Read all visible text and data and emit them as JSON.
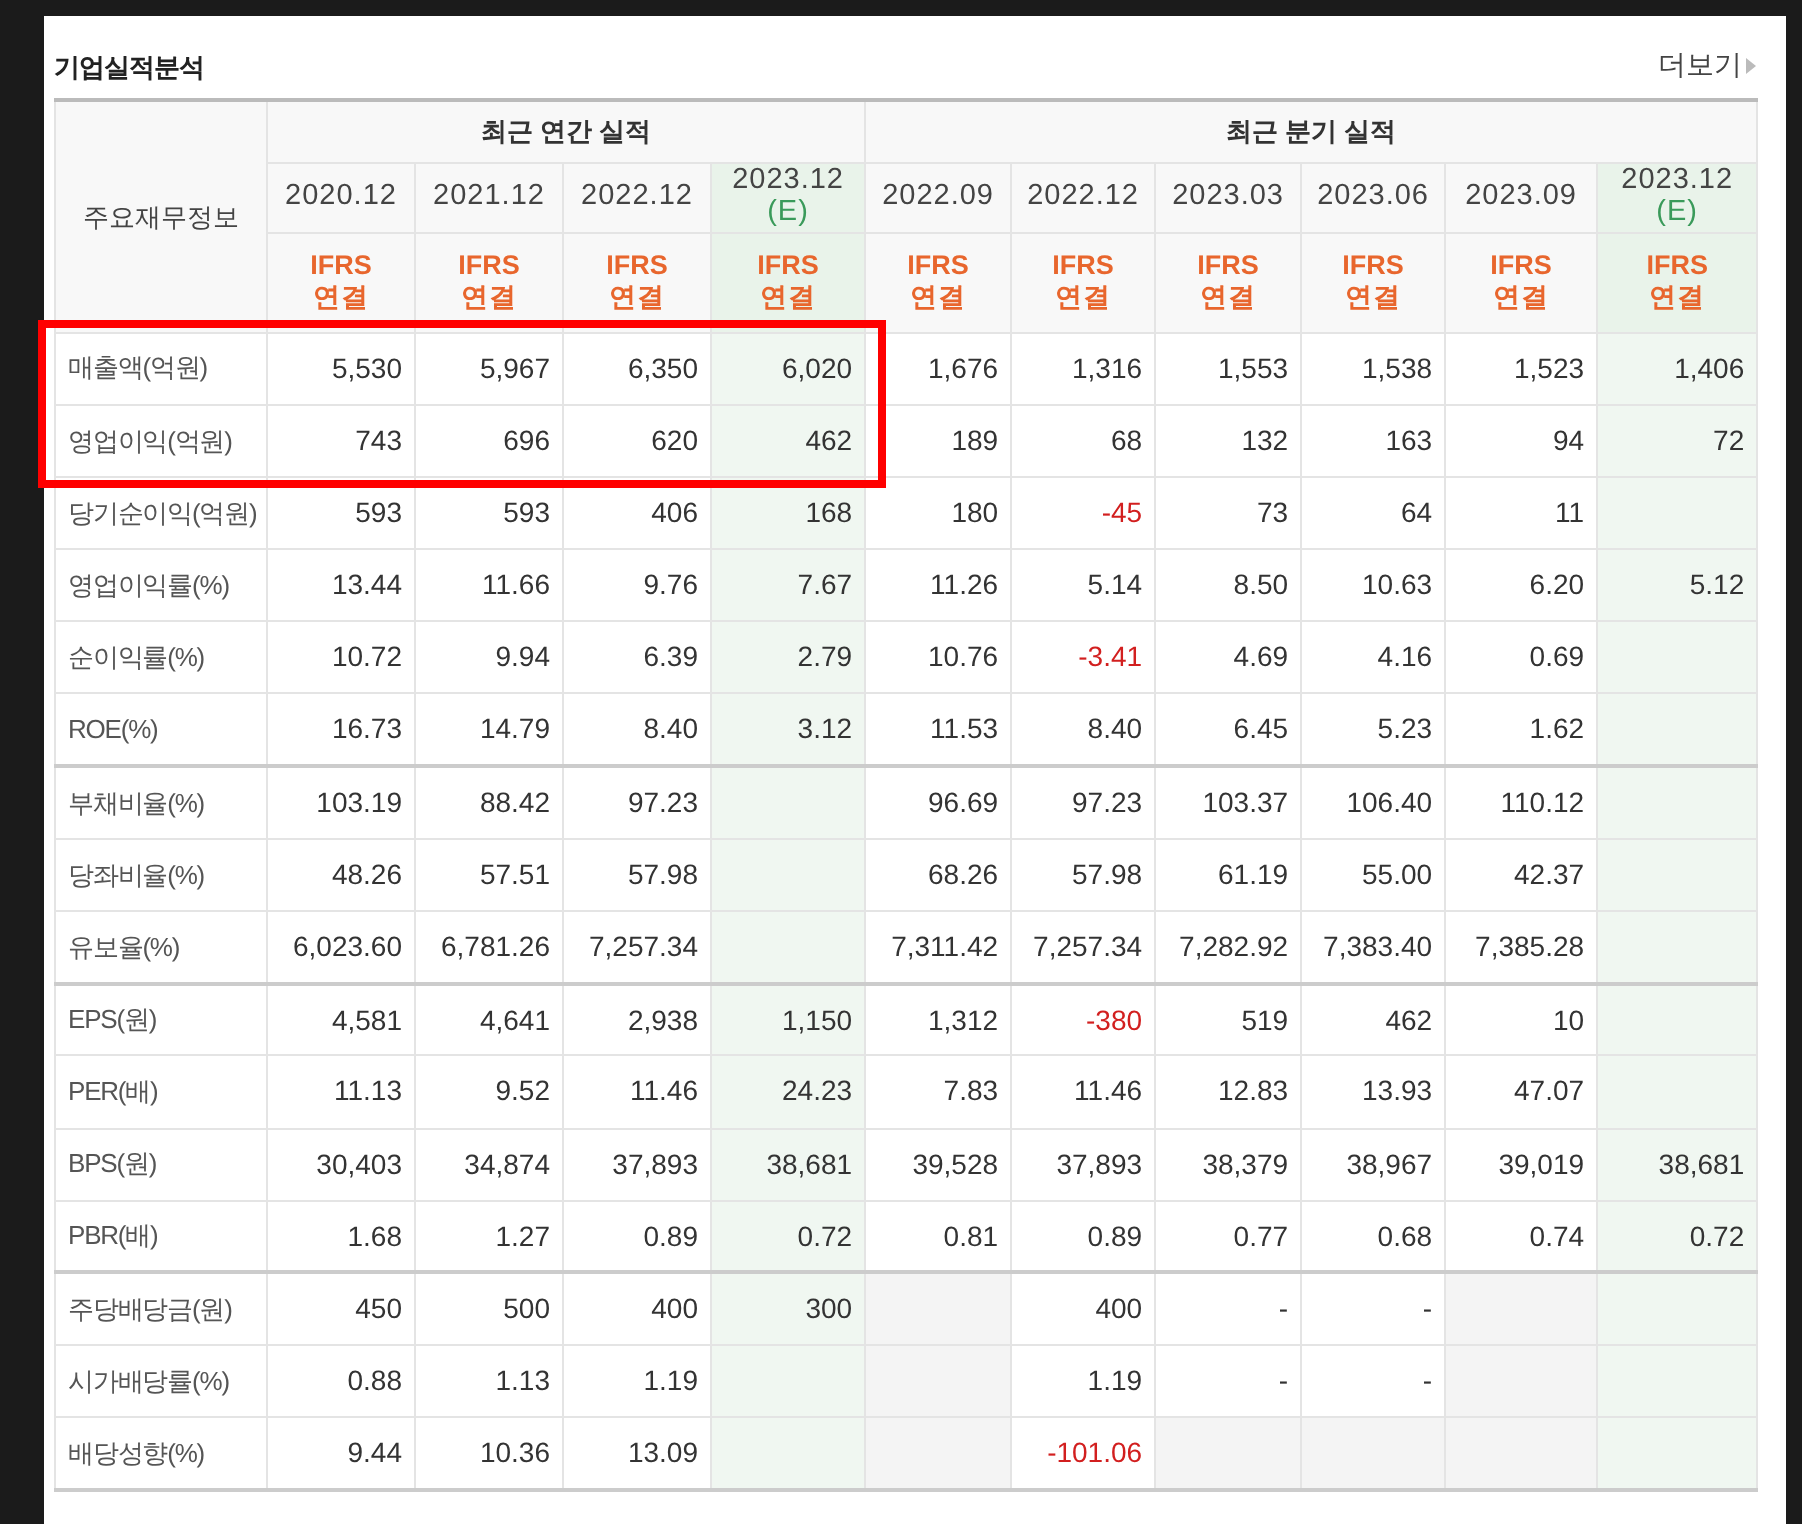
{
  "title": "기업실적분석",
  "more_link": {
    "label": "더보기"
  },
  "table": {
    "corner": "주요재무정보",
    "groups": [
      {
        "label": "최근 연간 실적",
        "columns": [
          {
            "date": "2020.12",
            "estimate": false,
            "basis": "IFRS",
            "scope": "연결"
          },
          {
            "date": "2021.12",
            "estimate": false,
            "basis": "IFRS",
            "scope": "연결"
          },
          {
            "date": "2022.12",
            "estimate": false,
            "basis": "IFRS",
            "scope": "연결"
          },
          {
            "date": "2023.12",
            "note": "(E)",
            "estimate": true,
            "basis": "IFRS",
            "scope": "연결"
          }
        ]
      },
      {
        "label": "최근 분기 실적",
        "columns": [
          {
            "date": "2022.09",
            "estimate": false,
            "basis": "IFRS",
            "scope": "연결"
          },
          {
            "date": "2022.12",
            "estimate": false,
            "basis": "IFRS",
            "scope": "연결"
          },
          {
            "date": "2023.03",
            "estimate": false,
            "basis": "IFRS",
            "scope": "연결"
          },
          {
            "date": "2023.06",
            "estimate": false,
            "basis": "IFRS",
            "scope": "연결"
          },
          {
            "date": "2023.09",
            "estimate": false,
            "basis": "IFRS",
            "scope": "연결"
          },
          {
            "date": "2023.12",
            "note": "(E)",
            "estimate": true,
            "basis": "IFRS",
            "scope": "연결"
          }
        ]
      }
    ],
    "sections": [
      {
        "rows": [
          {
            "label": "매출액(억원)",
            "highlighted": true,
            "cells": [
              "5,530",
              "5,967",
              "6,350",
              "6,020",
              "1,676",
              "1,316",
              "1,553",
              "1,538",
              "1,523",
              "1,406"
            ]
          },
          {
            "label": "영업이익(억원)",
            "highlighted": true,
            "cells": [
              "743",
              "696",
              "620",
              "462",
              "189",
              "68",
              "132",
              "163",
              "94",
              "72"
            ]
          },
          {
            "label": "당기순이익(억원)",
            "highlighted": false,
            "cells": [
              "593",
              "593",
              "406",
              "168",
              "180",
              {
                "text": "-45",
                "negative": true
              },
              "73",
              "64",
              "11",
              null
            ]
          },
          {
            "label": "영업이익률(%)",
            "highlighted": false,
            "cells": [
              "13.44",
              "11.66",
              "9.76",
              "7.67",
              "11.26",
              "5.14",
              "8.50",
              "10.63",
              "6.20",
              "5.12"
            ]
          },
          {
            "label": "순이익률(%)",
            "highlighted": false,
            "cells": [
              "10.72",
              "9.94",
              "6.39",
              "2.79",
              "10.76",
              {
                "text": "-3.41",
                "negative": true
              },
              "4.69",
              "4.16",
              "0.69",
              null
            ]
          },
          {
            "label": "ROE(%)",
            "highlighted": false,
            "cells": [
              "16.73",
              "14.79",
              "8.40",
              "3.12",
              "11.53",
              "8.40",
              "6.45",
              "5.23",
              "1.62",
              null
            ]
          }
        ]
      },
      {
        "rows": [
          {
            "label": "부채비율(%)",
            "highlighted": false,
            "cells": [
              "103.19",
              "88.42",
              "97.23",
              null,
              "96.69",
              "97.23",
              "103.37",
              "106.40",
              "110.12",
              null
            ]
          },
          {
            "label": "당좌비율(%)",
            "highlighted": false,
            "cells": [
              "48.26",
              "57.51",
              "57.98",
              null,
              "68.26",
              "57.98",
              "61.19",
              "55.00",
              "42.37",
              null
            ]
          },
          {
            "label": "유보율(%)",
            "highlighted": false,
            "cells": [
              "6,023.60",
              "6,781.26",
              "7,257.34",
              null,
              "7,311.42",
              "7,257.34",
              "7,282.92",
              "7,383.40",
              "7,385.28",
              null
            ]
          }
        ]
      },
      {
        "rows": [
          {
            "label": "EPS(원)",
            "highlighted": false,
            "cells": [
              "4,581",
              "4,641",
              "2,938",
              "1,150",
              "1,312",
              {
                "text": "-380",
                "negative": true
              },
              "519",
              "462",
              "10",
              null
            ]
          },
          {
            "label": "PER(배)",
            "highlighted": false,
            "cells": [
              "11.13",
              "9.52",
              "11.46",
              "24.23",
              "7.83",
              "11.46",
              "12.83",
              "13.93",
              "47.07",
              null
            ]
          },
          {
            "label": "BPS(원)",
            "highlighted": false,
            "cells": [
              "30,403",
              "34,874",
              "37,893",
              "38,681",
              "39,528",
              "37,893",
              "38,379",
              "38,967",
              "39,019",
              "38,681"
            ]
          },
          {
            "label": "PBR(배)",
            "highlighted": false,
            "cells": [
              "1.68",
              "1.27",
              "0.89",
              "0.72",
              "0.81",
              "0.89",
              "0.77",
              "0.68",
              "0.74",
              "0.72"
            ]
          }
        ]
      },
      {
        "rows": [
          {
            "label": "주당배당금(원)",
            "highlighted": false,
            "cells": [
              "450",
              "500",
              "400",
              "300",
              {
                "shaded": true
              },
              "400",
              "-",
              "-",
              {
                "shaded": true
              },
              null
            ]
          },
          {
            "label": "시가배당률(%)",
            "highlighted": false,
            "cells": [
              "0.88",
              "1.13",
              "1.19",
              null,
              {
                "shaded": true
              },
              "1.19",
              "-",
              "-",
              {
                "shaded": true
              },
              null
            ]
          },
          {
            "label": "배당성향(%)",
            "highlighted": false,
            "cells": [
              "9.44",
              "10.36",
              "13.09",
              null,
              {
                "shaded": true
              },
              {
                "text": "-101.06",
                "negative": true
              },
              {
                "shaded": true
              },
              {
                "shaded": true
              },
              {
                "shaded": true
              },
              null
            ]
          }
        ]
      }
    ]
  }
}
